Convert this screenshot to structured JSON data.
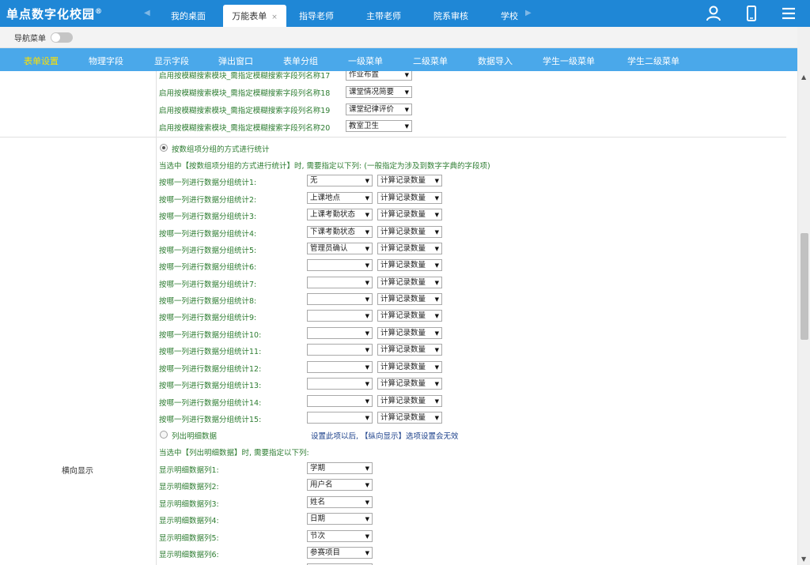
{
  "app": {
    "logo_text": "单点数字化校园",
    "logo_mark": "®"
  },
  "tabs": [
    {
      "label": "我的桌面",
      "active": false
    },
    {
      "label": "万能表单",
      "active": true,
      "close": "×"
    },
    {
      "label": "指导老师",
      "active": false
    },
    {
      "label": "主带老师",
      "active": false
    },
    {
      "label": "院系审核",
      "active": false
    },
    {
      "label": "学校",
      "active": false
    }
  ],
  "top_icons": [
    "user-icon",
    "mobile-icon",
    "menu-icon"
  ],
  "nav": {
    "label": "导航菜单",
    "toggle_on": false
  },
  "menu": [
    {
      "label": "表单设置",
      "active": true
    },
    {
      "label": "物理字段"
    },
    {
      "label": "显示字段"
    },
    {
      "label": "弹出窗口"
    },
    {
      "label": "表单分组"
    },
    {
      "label": "一级菜单"
    },
    {
      "label": "二级菜单"
    },
    {
      "label": "数据导入"
    },
    {
      "label": "学生一级菜单"
    },
    {
      "label": "学生二级菜单"
    }
  ],
  "fuzzy_search": [
    {
      "label": "启用按模糊搜索模块_需指定模糊搜索字段列名称17",
      "value": "作业布置"
    },
    {
      "label": "启用按模糊搜索模块_需指定模糊搜索字段列名称18",
      "value": "课堂情况简要"
    },
    {
      "label": "启用按模糊搜索模块_需指定模糊搜索字段列名称19",
      "value": "课堂纪律评价"
    },
    {
      "label": "启用按模糊搜索模块_需指定模糊搜索字段列名称20",
      "value": "教室卫生"
    }
  ],
  "section": {
    "title": "横向显示"
  },
  "group_stats": {
    "radio_label": "按数组项分组的方式进行统计",
    "checked": true,
    "note": "当选中【按数组项分组的方式进行统计】时, 需要指定以下列: (一般指定为涉及到数字字典的字段项)",
    "rows": [
      {
        "label": "按哪一列进行数据分组统计1:",
        "field": "无",
        "agg": "计算记录数量"
      },
      {
        "label": "按哪一列进行数据分组统计2:",
        "field": "上课地点",
        "agg": "计算记录数量"
      },
      {
        "label": "按哪一列进行数据分组统计3:",
        "field": "上课考勤状态",
        "agg": "计算记录数量"
      },
      {
        "label": "按哪一列进行数据分组统计4:",
        "field": "下课考勤状态",
        "agg": "计算记录数量"
      },
      {
        "label": "按哪一列进行数据分组统计5:",
        "field": "管理员确认",
        "agg": "计算记录数量"
      },
      {
        "label": "按哪一列进行数据分组统计6:",
        "field": "",
        "agg": "计算记录数量"
      },
      {
        "label": "按哪一列进行数据分组统计7:",
        "field": "",
        "agg": "计算记录数量"
      },
      {
        "label": "按哪一列进行数据分组统计8:",
        "field": "",
        "agg": "计算记录数量"
      },
      {
        "label": "按哪一列进行数据分组统计9:",
        "field": "",
        "agg": "计算记录数量"
      },
      {
        "label": "按哪一列进行数据分组统计10:",
        "field": "",
        "agg": "计算记录数量"
      },
      {
        "label": "按哪一列进行数据分组统计11:",
        "field": "",
        "agg": "计算记录数量"
      },
      {
        "label": "按哪一列进行数据分组统计12:",
        "field": "",
        "agg": "计算记录数量"
      },
      {
        "label": "按哪一列进行数据分组统计13:",
        "field": "",
        "agg": "计算记录数量"
      },
      {
        "label": "按哪一列进行数据分组统计14:",
        "field": "",
        "agg": "计算记录数量"
      },
      {
        "label": "按哪一列进行数据分组统计15:",
        "field": "",
        "agg": "计算记录数量"
      }
    ]
  },
  "detail": {
    "radio_label": "列出明细数据",
    "checked": false,
    "hint": "设置此项以后, 【纵向显示】选项设置会无效",
    "note": "当选中【列出明细数据】时, 需要指定以下列:",
    "rows": [
      {
        "label": "显示明细数据列1:",
        "value": "学期"
      },
      {
        "label": "显示明细数据列2:",
        "value": "用户名"
      },
      {
        "label": "显示明细数据列3:",
        "value": "姓名"
      },
      {
        "label": "显示明细数据列4:",
        "value": "日期"
      },
      {
        "label": "显示明细数据列5:",
        "value": "节次"
      },
      {
        "label": "显示明细数据列6:",
        "value": "参赛项目"
      }
    ]
  },
  "colors": {
    "topbar": "#1f87d6",
    "menubar": "#4aa8ea",
    "active_menu": "#ffe100",
    "label_green": "#2e7d32",
    "hint_blue": "#1a3f8a"
  }
}
